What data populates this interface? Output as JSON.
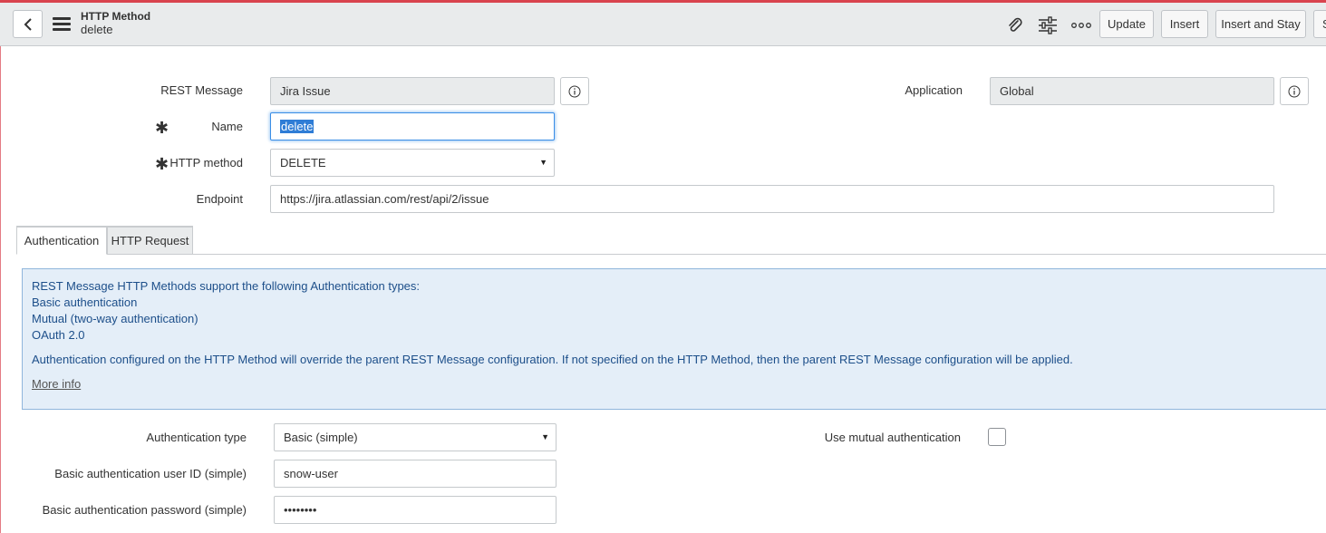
{
  "header": {
    "title": "HTTP Method",
    "subtitle": "delete",
    "buttons": {
      "update": "Update",
      "insert": "Insert",
      "insert_and_stay": "Insert and Stay",
      "partial": "S"
    }
  },
  "form": {
    "rest_message": {
      "label": "REST Message",
      "value": "Jira Issue"
    },
    "application": {
      "label": "Application",
      "value": "Global"
    },
    "name": {
      "label": "Name",
      "value": "delete"
    },
    "http_method": {
      "label": "HTTP method",
      "value": "DELETE"
    },
    "endpoint": {
      "label": "Endpoint",
      "value": "https://jira.atlassian.com/rest/api/2/issue"
    }
  },
  "tabs": [
    {
      "label": "Authentication",
      "active": true
    },
    {
      "label": "HTTP Request",
      "active": false
    }
  ],
  "info": {
    "line1": "REST Message HTTP Methods support the following Authentication types:",
    "line2": "Basic authentication",
    "line3": "Mutual (two-way authentication)",
    "line4": "OAuth 2.0",
    "line5": "Authentication configured on the HTTP Method will override the parent REST Message configuration. If not specified on the HTTP Method, then the parent REST Message configuration will be applied.",
    "link": "More info"
  },
  "auth": {
    "type": {
      "label": "Authentication type",
      "value": "Basic (simple)"
    },
    "user_id": {
      "label": "Basic authentication user ID (simple)",
      "value": "snow-user"
    },
    "password": {
      "label": "Basic authentication password (simple)",
      "value": "••••••••"
    },
    "mutual": {
      "label": "Use mutual authentication",
      "checked": false
    }
  },
  "colors": {
    "accent_bar": "#d9434e",
    "info_bg": "#e4eef8",
    "info_text": "#1d4f8a",
    "focus": "#3a8ee6"
  }
}
